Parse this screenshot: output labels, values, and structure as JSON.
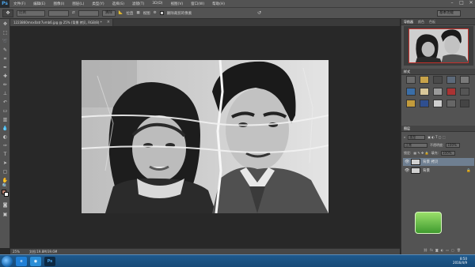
{
  "app": {
    "logo_text": "Ps"
  },
  "menu": [
    "文件(F)",
    "编辑(E)",
    "图像(I)",
    "图层(L)",
    "类型(Y)",
    "选择(S)",
    "滤镜(T)",
    "3D(D)",
    "视图(V)",
    "窗口(W)",
    "帮助(H)"
  ],
  "window_controls": {
    "minimize": "–",
    "maximize": "□",
    "close": "✕"
  },
  "options": {
    "tool_icon": "✥",
    "style_value": "比例",
    "refine_btn": "清除",
    "straighten_label": "拉直",
    "view_label": "视图",
    "checkbox_label": "删除裁剪的像素",
    "workspace": "基本功能"
  },
  "document": {
    "tab_title": "1223860mnx0atr7vmb6.jpg @ 25% (背景 拷贝, RGB/8) *",
    "close": "×",
    "zoom": "25%",
    "doc_info": "文档:19.8M/39.6M"
  },
  "panels": {
    "navigator_tabs": [
      "导航器",
      "颜色",
      "色板"
    ],
    "styles_tabs": [
      "样式"
    ],
    "layers_tabs": [
      "图层"
    ],
    "kind_label": "类型",
    "blend_mode": "正常",
    "opacity_label": "不透明度:",
    "opacity_value": "100%",
    "lock_label": "锁定:",
    "fill_label": "填充:",
    "fill_value": "100%",
    "layers": [
      {
        "name": "背景 拷贝",
        "active": true
      },
      {
        "name": "背景",
        "active": false
      }
    ]
  },
  "taskbar": {
    "time": "8:50",
    "date": "2016/4/9"
  },
  "colors": {
    "foreground": "#b57e6d",
    "background": "#f5f5f5",
    "ui_dark": "#535353",
    "canvas_bg": "#282828"
  }
}
